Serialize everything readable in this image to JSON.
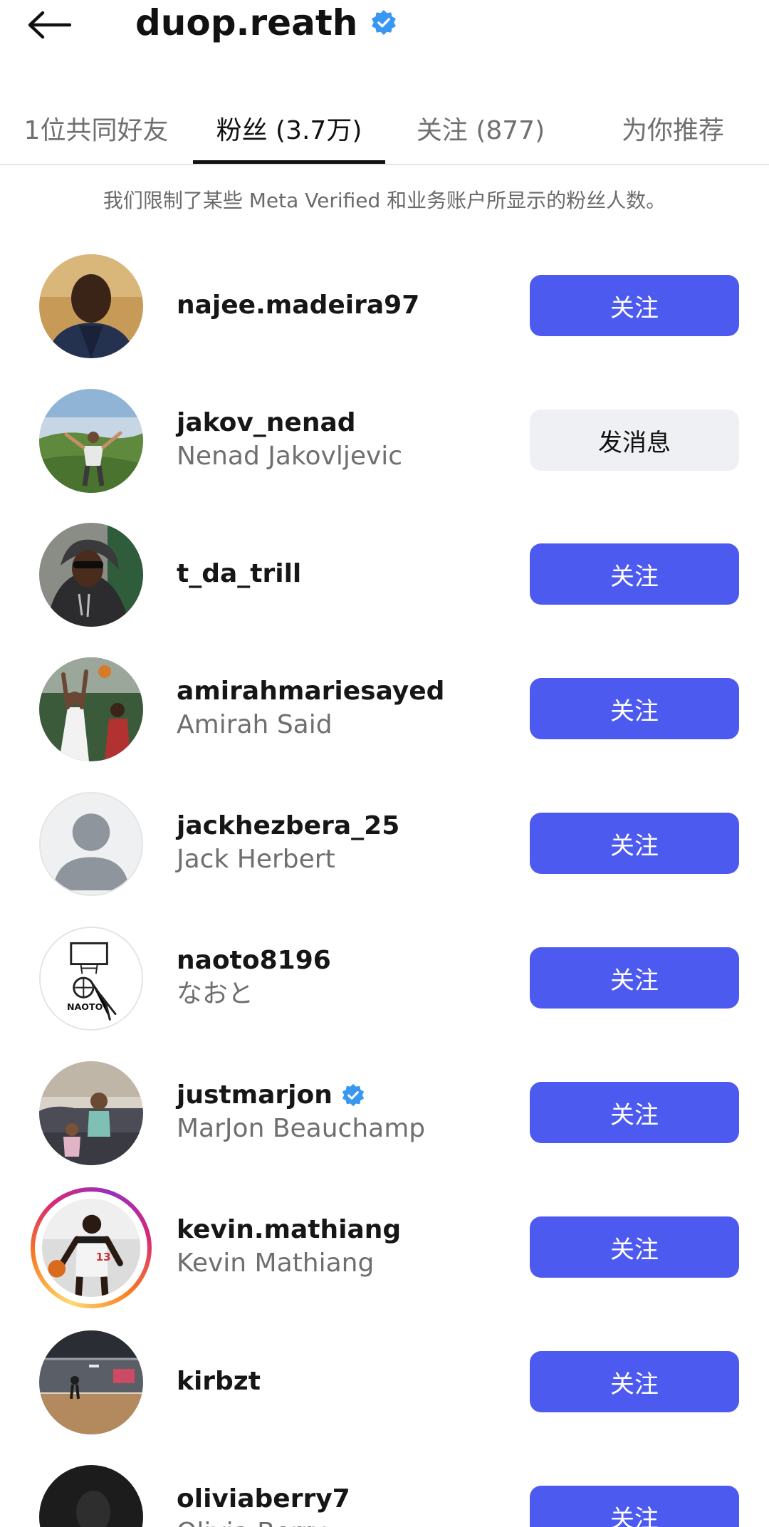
{
  "header": {
    "title": "duop.reath",
    "verified": true
  },
  "tabs": [
    {
      "label": "1位共同好友",
      "active": false
    },
    {
      "label": "粉丝 (3.7万)",
      "active": true
    },
    {
      "label": "关注 (877)",
      "active": false
    },
    {
      "label": "为你推荐",
      "active": false
    }
  ],
  "notice": "我们限制了某些 Meta Verified 和业务账户所显示的粉丝人数。",
  "colors": {
    "follow_button": "#4d5af0",
    "message_button": "#eef0f4",
    "verified_badge": "#3897f0"
  },
  "followers": [
    {
      "username": "najee.madeira97",
      "full_name": "",
      "verified": false,
      "button": "关注",
      "button_type": "follow",
      "avatar": "photo-portrait-dark",
      "story": false
    },
    {
      "username": "jakov_nenad",
      "full_name": "Nenad Jakovljevic",
      "verified": false,
      "button": "发消息",
      "button_type": "message",
      "avatar": "photo-mountain-landscape",
      "story": false
    },
    {
      "username": "t_da_trill",
      "full_name": "",
      "verified": false,
      "button": "关注",
      "button_type": "follow",
      "avatar": "photo-hoodie-sunglasses",
      "story": false
    },
    {
      "username": "amirahmariesayed",
      "full_name": "Amirah Said",
      "verified": false,
      "button": "关注",
      "button_type": "follow",
      "avatar": "photo-basketball-players",
      "story": false
    },
    {
      "username": "jackhezbera_25",
      "full_name": "Jack Herbert",
      "verified": false,
      "button": "关注",
      "button_type": "follow",
      "avatar": "default-person-silhouette",
      "story": false
    },
    {
      "username": "naoto8196",
      "full_name": "なおと",
      "verified": false,
      "button": "关注",
      "button_type": "follow",
      "avatar": "drawing-basketball-hoop",
      "story": false
    },
    {
      "username": "justmarjon",
      "full_name": "MarJon Beauchamp",
      "verified": true,
      "button": "关注",
      "button_type": "follow",
      "avatar": "photo-kids-on-couch",
      "story": false
    },
    {
      "username": "kevin.mathiang",
      "full_name": "Kevin Mathiang",
      "verified": false,
      "button": "关注",
      "button_type": "follow",
      "avatar": "photo-basketball-player-jersey",
      "story": true
    },
    {
      "username": "kirbzt",
      "full_name": "",
      "verified": false,
      "button": "关注",
      "button_type": "follow",
      "avatar": "photo-basketball-gym",
      "story": false
    },
    {
      "username": "oliviaberry7",
      "full_name": "Olivia Berry",
      "verified": false,
      "button": "关注",
      "button_type": "follow",
      "avatar": "photo-dark-portrait",
      "story": false
    }
  ]
}
